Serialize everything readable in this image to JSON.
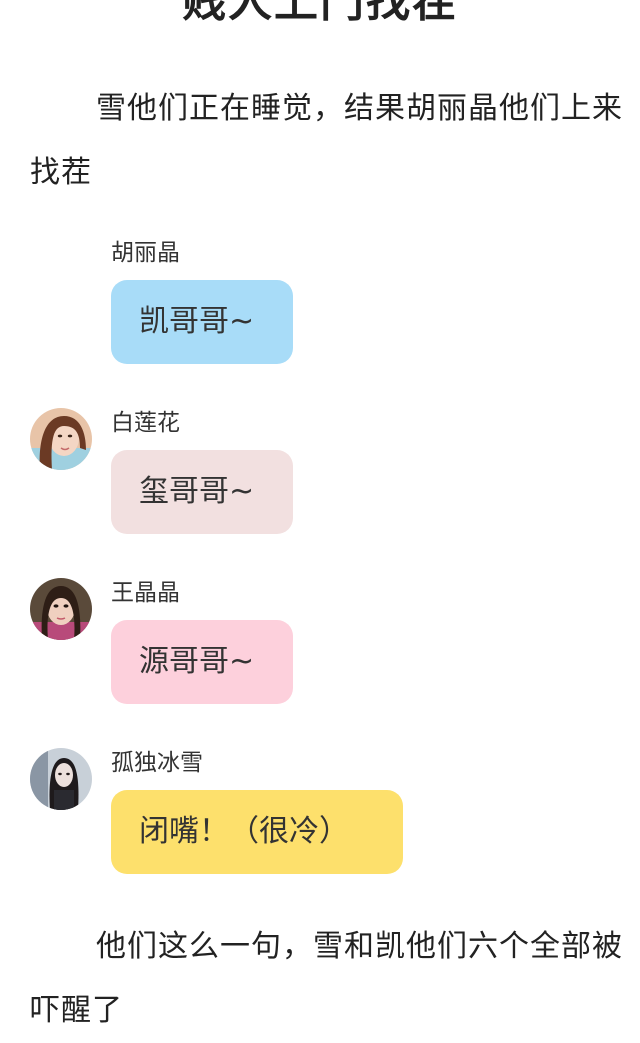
{
  "title": "贱人上门找茬",
  "paragraphs": {
    "intro": "雪他们正在睡觉，结果胡丽晶他们上来找茬",
    "outro": "他们这么一句，雪和凯他们六个全部被吓醒了"
  },
  "messages": [
    {
      "sender": "胡丽晶",
      "text": "凯哥哥~",
      "bubble_color": "#a8dcf8",
      "avatar": "none"
    },
    {
      "sender": "白莲花",
      "text": "玺哥哥~",
      "bubble_color": "#f2e0e0",
      "avatar": "girl-photo-avatar"
    },
    {
      "sender": "王晶晶",
      "text": "源哥哥~",
      "bubble_color": "#fdd0dc",
      "avatar": "girl-photo-avatar"
    },
    {
      "sender": "孤独冰雪",
      "text": "闭嘴！（很冷）",
      "bubble_color": "#fde06c",
      "avatar": "girl-photo-avatar"
    }
  ]
}
